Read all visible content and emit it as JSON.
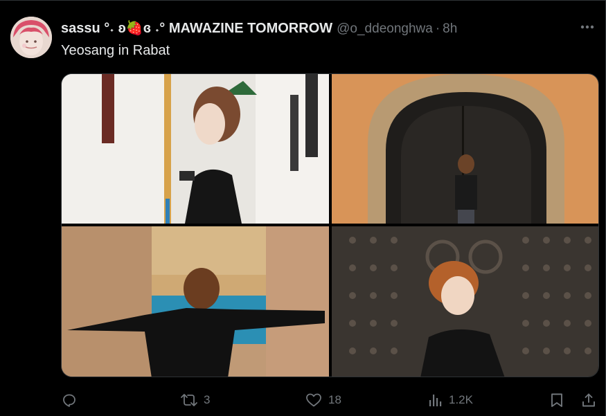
{
  "tweet": {
    "display_name": "sassu °˖ ʚ🍓ɞ ˖° MAWAZINE TOMORROW",
    "handle": "@o_ddeonghwa",
    "separator": "·",
    "time": "8h",
    "text": "Yeosang in Rabat"
  },
  "icons": {
    "more": "more-horizontal-icon",
    "reply": "reply-icon",
    "retweet": "retweet-icon",
    "like": "heart-icon",
    "views": "views-icon",
    "bookmark": "bookmark-icon",
    "share": "share-icon"
  },
  "stats": {
    "reply_count": "",
    "retweets": "3",
    "likes": "18",
    "views": "1.2K"
  },
  "colors": {
    "background": "#000000",
    "text": "#e7e9ea",
    "muted": "#71767b",
    "border": "#2f3336"
  }
}
